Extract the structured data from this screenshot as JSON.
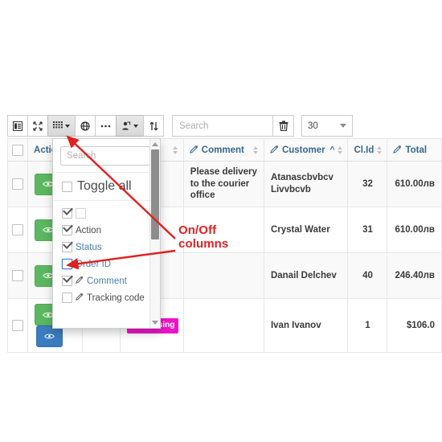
{
  "toolbar": {
    "buttons": [
      {
        "name": "card-view-button",
        "icon": "card-view-icon",
        "active": false
      },
      {
        "name": "fullscreen-button",
        "icon": "fullscreen-expand-icon",
        "active": false
      },
      {
        "name": "columns-button",
        "icon": "grid-columns-icon",
        "active": true,
        "has_caret": true
      },
      {
        "name": "globe-button",
        "icon": "globe-icon",
        "active": false
      },
      {
        "name": "more-button",
        "icon": "ellipsis-icon",
        "active": false
      },
      {
        "name": "export-button",
        "icon": "export-icon",
        "active": true,
        "has_caret": true
      },
      {
        "name": "sort-button",
        "icon": "sort-updown-icon",
        "active": false
      }
    ],
    "search_placeholder": "Search",
    "search_value": "",
    "trash_icon": "trash-icon",
    "page_size": "30"
  },
  "columns_dropdown": {
    "search_placeholder": "Search",
    "search_value": "",
    "toggle_all_label": "Toggle all",
    "toggle_all_checked": false,
    "items": [
      {
        "label": "",
        "checked": true,
        "has_edit_icon": false,
        "highlighted": false,
        "blank_label_box": true
      },
      {
        "label": "Action",
        "checked": true,
        "has_edit_icon": false,
        "highlighted": false
      },
      {
        "label": "Status",
        "checked": true,
        "has_edit_icon": false,
        "highlighted": false
      },
      {
        "label": "Order ID",
        "checked": false,
        "has_edit_icon": false,
        "highlighted": true
      },
      {
        "label": "Comment",
        "checked": true,
        "has_edit_icon": true,
        "highlighted": false
      },
      {
        "label": "Tracking code",
        "checked": false,
        "has_edit_icon": true,
        "highlighted": false
      }
    ]
  },
  "annotation": {
    "text": "On/Off\ncolumns",
    "color": "#e41f1f"
  },
  "table": {
    "headers": [
      {
        "label": "",
        "name": "select-all-header",
        "type": "checkbox"
      },
      {
        "label": "Action",
        "name": "header-action",
        "edit_icon": false,
        "sortable": false
      },
      {
        "label": "",
        "name": "header-hidden-1",
        "edit_icon": false,
        "sortable": true
      },
      {
        "label": "",
        "name": "header-hidden-2",
        "edit_icon": false,
        "sortable": true
      },
      {
        "label": "Comment",
        "name": "header-comment",
        "edit_icon": true,
        "sortable": true
      },
      {
        "label": "Customer",
        "name": "header-customer",
        "edit_icon": true,
        "sortable": true,
        "sort_dir": "asc"
      },
      {
        "label": "Cl.Id",
        "name": "header-clid",
        "edit_icon": false,
        "sortable": true
      },
      {
        "label": "Total",
        "name": "header-total",
        "edit_icon": true,
        "sortable": false
      }
    ],
    "rows": [
      {
        "comment": "Please delivery to the courier office",
        "customer": "Atanascbvbcv Livvbcvb",
        "clid": "32",
        "total": "610.00лв",
        "status": "",
        "stripe": "odd"
      },
      {
        "comment": "",
        "customer": "Crystal Water",
        "clid": "31",
        "total": "610.00лв",
        "status": "",
        "stripe": "even"
      },
      {
        "comment": "",
        "customer": "Danail Delchev",
        "clid": "40",
        "total": "246.40лв",
        "status": "",
        "stripe": "odd"
      },
      {
        "comment": "",
        "customer": "Ivan Ivanov",
        "clid": "1",
        "total": "$106.0",
        "status": "Processing",
        "stripe": "even"
      }
    ]
  },
  "colors": {
    "accent_blue": "#37678f",
    "success_green": "#5cb860",
    "primary_blue": "#3b7dbf",
    "status_magenta": "#ef14c8",
    "annotation_red": "#e41f1f",
    "teal": "#2aa198"
  }
}
